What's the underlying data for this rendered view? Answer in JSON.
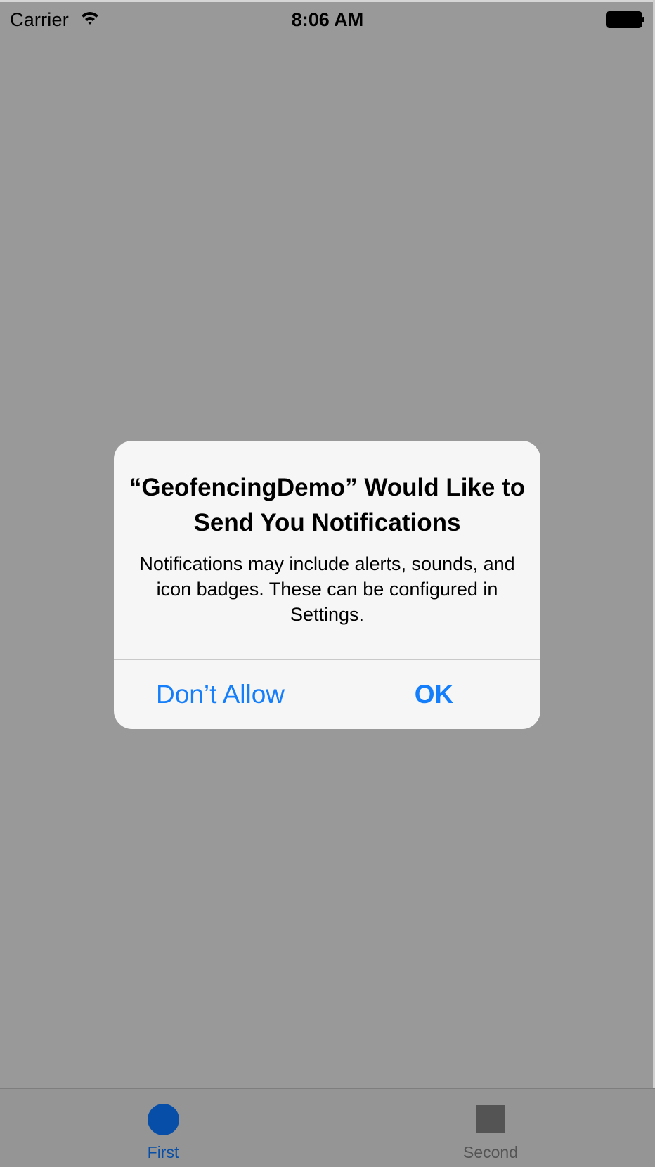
{
  "status_bar": {
    "carrier": "Carrier",
    "wifi_icon": "wifi-icon",
    "time": "8:06 AM",
    "battery_icon": "battery-icon"
  },
  "alert": {
    "title": "“GeofencingDemo” Would Like to Send You Notifications",
    "message": "Notifications may include alerts, sounds, and icon badges. These can be configured in Settings.",
    "buttons": {
      "dont_allow": "Don’t Allow",
      "ok": "OK"
    }
  },
  "tab_bar": {
    "tabs": [
      {
        "label": "First",
        "icon": "circle-icon",
        "selected": true
      },
      {
        "label": "Second",
        "icon": "square-icon",
        "selected": false
      }
    ]
  },
  "colors": {
    "dimmed_background": "#999999",
    "alert_background": "#f6f6f6",
    "button_text": "#157efb",
    "tab_selected": "#064ea8",
    "tab_unselected": "#545454"
  }
}
